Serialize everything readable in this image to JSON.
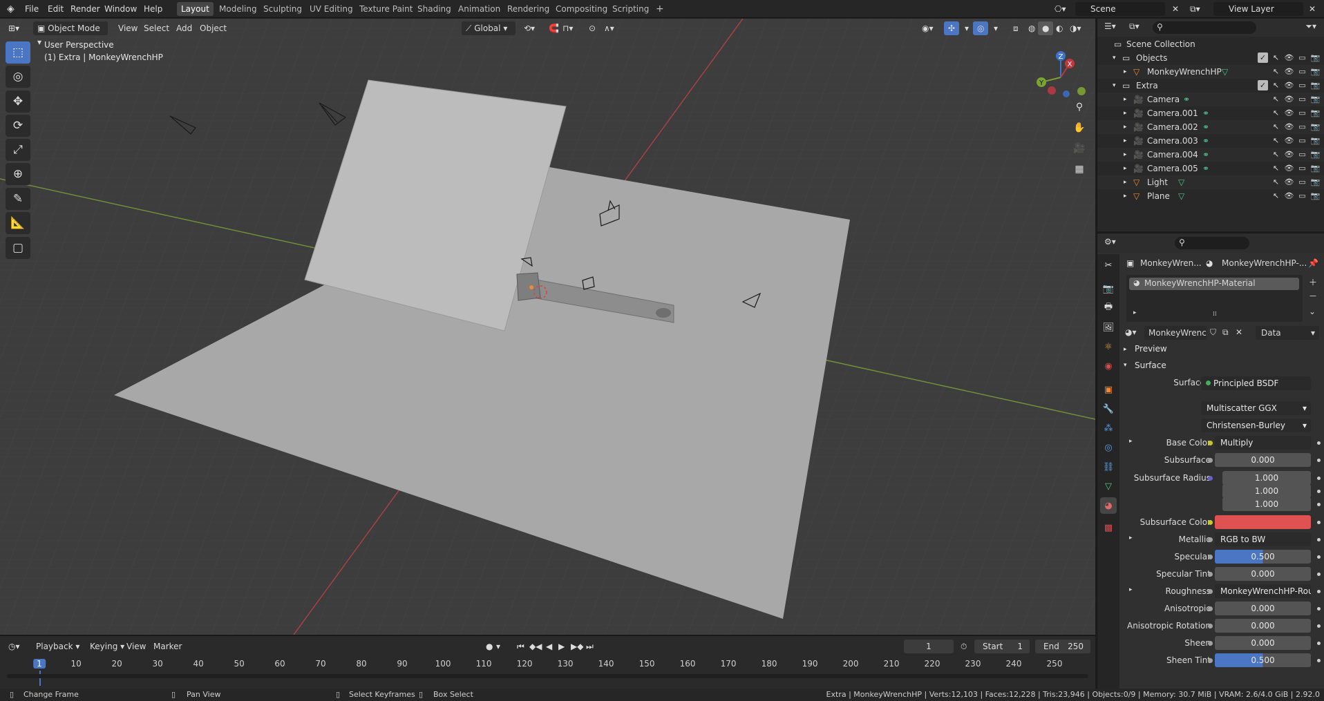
{
  "topbar": {
    "menus": [
      "File",
      "Edit",
      "Render",
      "Window",
      "Help"
    ],
    "workspaces": [
      "Layout",
      "Modeling",
      "Sculpting",
      "UV Editing",
      "Texture Paint",
      "Shading",
      "Animation",
      "Rendering",
      "Compositing",
      "Scripting"
    ],
    "active_workspace": "Layout",
    "add_workspace": "+",
    "scene": "Scene",
    "view_layer": "View Layer"
  },
  "viewport": {
    "mode": "Object Mode",
    "menus": [
      "View",
      "Select",
      "Add",
      "Object"
    ],
    "orientation": "Global",
    "overlay_title": "User Perspective",
    "overlay_subtitle": "(1) Extra | MonkeyWrenchHP",
    "gizmo_axes": {
      "z": "Z",
      "y": "Y",
      "x": "X"
    },
    "colors": {
      "x_axis": "#c0383f",
      "y_axis": "#7aa331",
      "z_axis": "#3d72d0",
      "grid": "#3d3d3d",
      "plane": "#a9a9a9",
      "card": "#bdbdbd"
    }
  },
  "timeline": {
    "menus": [
      "Playback",
      "Keying",
      "View",
      "Marker"
    ],
    "current_frame": "1",
    "start_label": "Start",
    "start": "1",
    "end_label": "End",
    "end": "250",
    "ticks": [
      "1",
      "10",
      "20",
      "30",
      "40",
      "50",
      "60",
      "70",
      "80",
      "90",
      "100",
      "110",
      "120",
      "130",
      "140",
      "150",
      "160",
      "170",
      "180",
      "190",
      "200",
      "210",
      "220",
      "230",
      "240",
      "250"
    ]
  },
  "statusbar": {
    "change_frame": "Change Frame",
    "pan_view": "Pan View",
    "select_keyframes": "Select Keyframes",
    "box_select": "Box Select",
    "stats": "Extra | MonkeyWrenchHP | Verts:12,103 | Faces:12,228 | Tris:23,946 | Objects:0/9 | Memory: 30.7 MiB | VRAM: 2.6/4.0 GiB | 2.92.0"
  },
  "outliner": {
    "root": "Scene Collection",
    "rows": [
      {
        "label": "Objects",
        "type": "collection"
      },
      {
        "label": "MonkeyWrenchHP",
        "type": "mesh"
      },
      {
        "label": "Extra",
        "type": "collection"
      },
      {
        "label": "Camera",
        "type": "camera"
      },
      {
        "label": "Camera.001",
        "type": "camera"
      },
      {
        "label": "Camera.002",
        "type": "camera"
      },
      {
        "label": "Camera.003",
        "type": "camera"
      },
      {
        "label": "Camera.004",
        "type": "camera"
      },
      {
        "label": "Camera.005",
        "type": "camera"
      },
      {
        "label": "Light",
        "type": "mesh"
      },
      {
        "label": "Plane",
        "type": "mesh"
      }
    ]
  },
  "properties": {
    "breadcrumb_object": "MonkeyWren...",
    "breadcrumb_material": "MonkeyWrenchHP-...",
    "material_slot": "MonkeyWrenchHP-Material",
    "material_name": "MonkeyWrenc...",
    "link": "Data",
    "panel_preview": "Preview",
    "panel_surface": "Surface",
    "surface_label": "Surface",
    "surface_value": "Principled BSDF",
    "distribution": "Multiscatter GGX",
    "subsurface_method": "Christensen-Burley",
    "rows": [
      {
        "label": "Base Color",
        "value": "Multiply"
      },
      {
        "label": "Subsurface",
        "value": "0.000"
      },
      {
        "label": "Subsurface Radius",
        "value": "1.000"
      },
      {
        "label": "",
        "value": "1.000"
      },
      {
        "label": "",
        "value": "1.000"
      },
      {
        "label": "Subsurface Color",
        "value": ""
      },
      {
        "label": "Metallic",
        "value": "RGB to BW"
      },
      {
        "label": "Specular",
        "value": "0.500"
      },
      {
        "label": "Specular Tint",
        "value": "0.000"
      },
      {
        "label": "Roughness",
        "value": "MonkeyWrenchHP-Rough..."
      },
      {
        "label": "Anisotropic",
        "value": "0.000"
      },
      {
        "label": "Anisotropic Rotation",
        "value": "0.000"
      },
      {
        "label": "Sheen",
        "value": "0.000"
      },
      {
        "label": "Sheen Tint",
        "value": "0.500"
      }
    ],
    "specular_fill": 0.5,
    "sheen_tint_fill": 0.5,
    "subsurface_color": "#e05252"
  }
}
